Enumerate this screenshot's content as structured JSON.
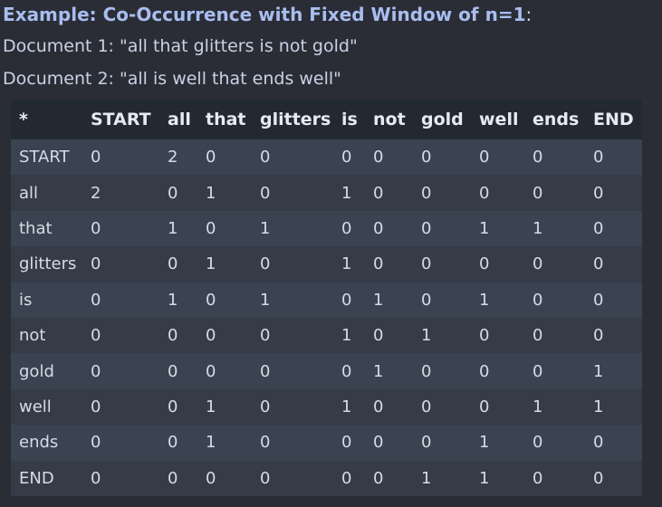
{
  "title": {
    "bold": "Example: Co-Occurrence with Fixed Window of n=1",
    "suffix": ":"
  },
  "documents": [
    "Document 1: \"all that glitters is not gold\"",
    "Document 2: \"all is well that ends well\""
  ],
  "table": {
    "headers": [
      "*",
      "START",
      "all",
      "that",
      "glitters",
      "is",
      "not",
      "gold",
      "well",
      "ends",
      "END"
    ],
    "rows": [
      [
        "START",
        "0",
        "2",
        "0",
        "0",
        "0",
        "0",
        "0",
        "0",
        "0",
        "0"
      ],
      [
        "all",
        "2",
        "0",
        "1",
        "0",
        "1",
        "0",
        "0",
        "0",
        "0",
        "0"
      ],
      [
        "that",
        "0",
        "1",
        "0",
        "1",
        "0",
        "0",
        "0",
        "1",
        "1",
        "0"
      ],
      [
        "glitters",
        "0",
        "0",
        "1",
        "0",
        "1",
        "0",
        "0",
        "0",
        "0",
        "0"
      ],
      [
        "is",
        "0",
        "1",
        "0",
        "1",
        "0",
        "1",
        "0",
        "1",
        "0",
        "0"
      ],
      [
        "not",
        "0",
        "0",
        "0",
        "0",
        "1",
        "0",
        "1",
        "0",
        "0",
        "0"
      ],
      [
        "gold",
        "0",
        "0",
        "0",
        "0",
        "0",
        "1",
        "0",
        "0",
        "0",
        "1"
      ],
      [
        "well",
        "0",
        "0",
        "1",
        "0",
        "1",
        "0",
        "0",
        "0",
        "1",
        "1"
      ],
      [
        "ends",
        "0",
        "0",
        "1",
        "0",
        "0",
        "0",
        "0",
        "1",
        "0",
        "0"
      ],
      [
        "END",
        "0",
        "0",
        "0",
        "0",
        "0",
        "0",
        "1",
        "1",
        "0",
        "0"
      ]
    ]
  }
}
